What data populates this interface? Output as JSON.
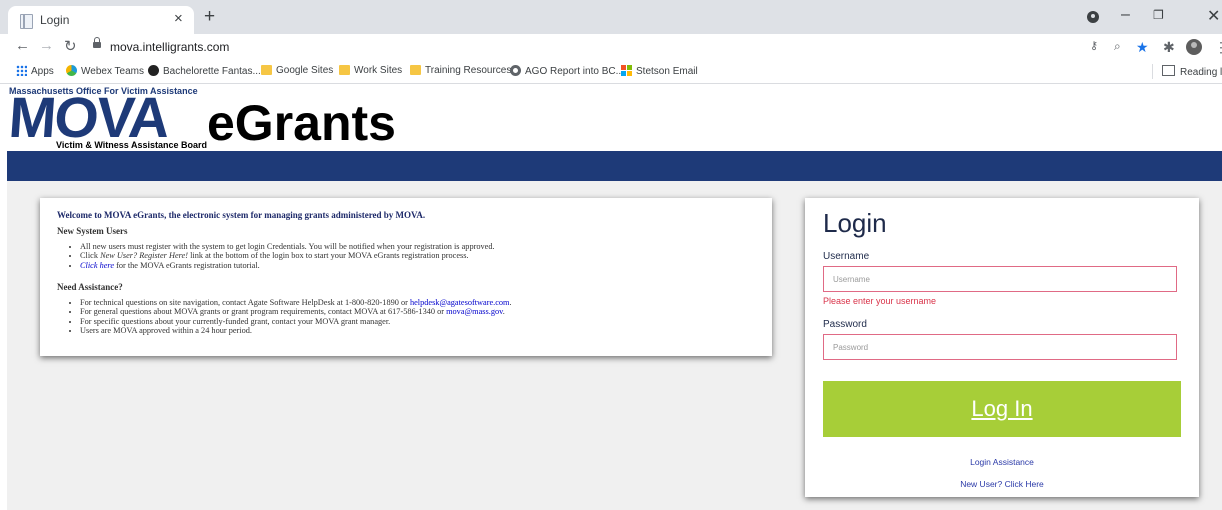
{
  "browser": {
    "tab_title": "Login",
    "tab_close": "×",
    "new_tab": "+",
    "url": "mova.intelligrants.com",
    "window_controls": [
      "–",
      "❐",
      "✕"
    ],
    "bookmarks": [
      {
        "label": "Apps",
        "icon": "apps-icon"
      },
      {
        "label": "Webex Teams",
        "icon": "webex-icon"
      },
      {
        "label": "Bachelorette Fantas...",
        "icon": "bachelorette-icon"
      },
      {
        "label": "Google Sites",
        "icon": "folder-icon"
      },
      {
        "label": "Work Sites",
        "icon": "folder-icon"
      },
      {
        "label": "Training Resources",
        "icon": "folder-icon"
      },
      {
        "label": "AGO Report into BC...",
        "icon": "globe-icon"
      },
      {
        "label": "Stetson Email",
        "icon": "microsoft-icon"
      }
    ],
    "reading_list": "Reading list"
  },
  "header": {
    "org_name": "Massachusetts Office For Victim Assistance",
    "logo_mova": "MOVA",
    "logo_egrants": "eGrants",
    "board_name": "Victim & Witness Assistance Board"
  },
  "welcome": {
    "title": "Welcome to MOVA eGrants, the electronic system for managing grants administered by MOVA.",
    "new_users_heading": "New System Users",
    "new_users_item1": "All new users must register with the system to get login Credentials. You will be notified when your registration is approved.",
    "new_users_item2_pre": "Click ",
    "new_users_item2_em": "New User? Register Here!",
    "new_users_item2_post": " link at the bottom of the login box to start your MOVA eGrants registration process.",
    "new_users_item3_link": "Click here",
    "new_users_item3_post": " for the MOVA eGrants registration tutorial.",
    "assist_heading": "Need Assistance?",
    "assist_item1_pre": "For technical questions on site navigation, contact Agate Software HelpDesk at 1-800-820-1890 or ",
    "assist_item1_link": "helpdesk@agatesoftware.com",
    "assist_item1_post": ".",
    "assist_item2_pre": "For general questions about MOVA grants or grant program requirements, contact MOVA at 617-586-1340 or ",
    "assist_item2_link": "mova@mass.gov",
    "assist_item2_post": ".",
    "assist_item3": "For specific questions about your currently-funded grant, contact your MOVA grant manager.",
    "assist_item4": "Users are MOVA approved within a 24 hour period."
  },
  "login": {
    "title": "Login",
    "username_label": "Username",
    "username_placeholder": "Username",
    "username_value": "",
    "username_error": "Please enter your username",
    "password_label": "Password",
    "password_placeholder": "Password",
    "password_value": "",
    "login_button": "Log In",
    "assistance_link": "Login Assistance",
    "register_link": "New User? Click Here",
    "button_color": "#a7ce38",
    "error_color": "#d9344a"
  },
  "colors": {
    "brand_blue": "#1e3a78",
    "content_bg": "#f0f0f0"
  }
}
